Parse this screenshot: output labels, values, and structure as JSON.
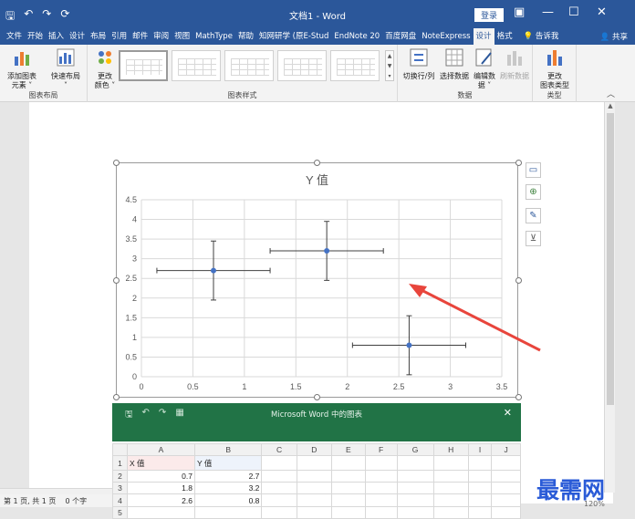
{
  "titlebar": {
    "doc_title": "文档1  -  Word",
    "login": "登录",
    "qat_save": "🖫",
    "qat_undo": "↶",
    "qat_redo": "↷",
    "qat_refresh": "⟳",
    "min": "—",
    "restore": "☐",
    "close": "✕",
    "ribbon_display": "▣"
  },
  "tabs": {
    "items": [
      "文件",
      "开始",
      "插入",
      "设计",
      "布局",
      "引用",
      "邮件",
      "审阅",
      "视图",
      "MathType",
      "帮助",
      "知网研学 (原E-Stud",
      "EndNote 20",
      "百度网盘",
      "NoteExpress",
      "设计",
      "格式"
    ],
    "tell_me": "告诉我",
    "share": "共享"
  },
  "ribbon": {
    "add_element": "添加图表\n元素 ˅",
    "quick_layout": "快速布局\n˅",
    "change_colors": "更改\n颜色 ˅",
    "switch_rowcol": "切换行/列",
    "select_data": "选择数据",
    "edit_data": "编辑数\n据 ˅",
    "refresh_data": "刷新数据",
    "change_type": "更改\n图表类型",
    "group_layout": "图表布局",
    "group_styles": "图表样式",
    "group_data": "数据",
    "group_type": "类型"
  },
  "chart_data": {
    "type": "scatter",
    "title": "Y 值",
    "xlim": [
      0,
      3.5
    ],
    "ylim": [
      0,
      4.5
    ],
    "x_ticks": [
      "0",
      "0.5",
      "1",
      "1.5",
      "2",
      "2.5",
      "3",
      "3.5"
    ],
    "y_ticks": [
      "0",
      "0.5",
      "1",
      "1.5",
      "2",
      "2.5",
      "3",
      "3.5",
      "4",
      "4.5"
    ],
    "grid": true,
    "series": [
      {
        "points": [
          {
            "x": 0.7,
            "y": 2.7,
            "x_err": 0.55,
            "y_err": 0.75
          },
          {
            "x": 1.8,
            "y": 3.2,
            "x_err": 0.55,
            "y_err": 0.75
          },
          {
            "x": 2.6,
            "y": 0.8,
            "x_err": 0.55,
            "y_err": 0.75
          }
        ],
        "color": "#4472c4"
      }
    ],
    "error_bar_color": "#404040",
    "annotation_arrow_color": "#e8453c"
  },
  "chart_tools": [
    "⊕",
    "✎",
    "⊻"
  ],
  "excel": {
    "title": "Microsoft Word 中的图表",
    "close": "✕",
    "columns": [
      "",
      "A",
      "B",
      "C",
      "D",
      "E",
      "F",
      "G",
      "H",
      "I",
      "J"
    ],
    "rows": [
      {
        "num": "1",
        "a": "X 值",
        "b": "Y 值"
      },
      {
        "num": "2",
        "a": "0.7",
        "b": "2.7"
      },
      {
        "num": "3",
        "a": "1.8",
        "b": "3.2"
      },
      {
        "num": "4",
        "a": "2.6",
        "b": "0.8"
      },
      {
        "num": "5",
        "a": "",
        "b": ""
      }
    ]
  },
  "status": {
    "page": "第 1 页, 共 1 页",
    "words": "0 个字",
    "zoom": "120%"
  },
  "watermark": "最需网"
}
